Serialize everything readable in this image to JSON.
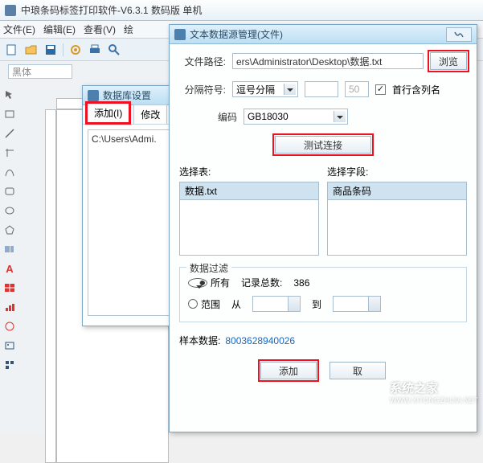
{
  "app": {
    "title": "中琅条码标签打印软件-V6.3.1 数码版 单机"
  },
  "menu": {
    "file": "文件(E)",
    "edit": "编辑(E)",
    "view": "查看(V)",
    "draw": "绘"
  },
  "font_field_placeholder": "黑体",
  "dbdlg": {
    "title": "数据库设置",
    "tab_add": "添加(I)",
    "tab_modify": "修改",
    "list_item": "C:\\Users\\Admi."
  },
  "dsdlg": {
    "title": "文本数据源管理(文件)",
    "lbl_path": "文件路径:",
    "path_value": "ers\\Administrator\\Desktop\\数据.txt",
    "btn_browse": "浏览",
    "lbl_delim": "分隔符号:",
    "delim_value": "逗号分隔",
    "delim_extra1": "",
    "delim_extra2": "50",
    "chk_header": "首行含列名",
    "lbl_encoding": "编码",
    "encoding_value": "GB18030",
    "btn_test": "测试连接",
    "lbl_select_table": "选择表:",
    "lbl_select_field": "选择字段:",
    "table_item": "数据.txt",
    "field_item": "商品条码",
    "group_filter": "数据过滤",
    "radio_all": "所有",
    "radio_range": "范围",
    "lbl_count": "记录总数:",
    "count_value": "386",
    "lbl_from": "从",
    "lbl_to": "到",
    "lbl_sample": "样本数据:",
    "sample_value": "8003628940026",
    "btn_add": "添加",
    "btn_cancel": "取"
  },
  "watermark": {
    "text1": "系统之家",
    "text2": "WWW.XITONGZHIJIA.NET"
  }
}
